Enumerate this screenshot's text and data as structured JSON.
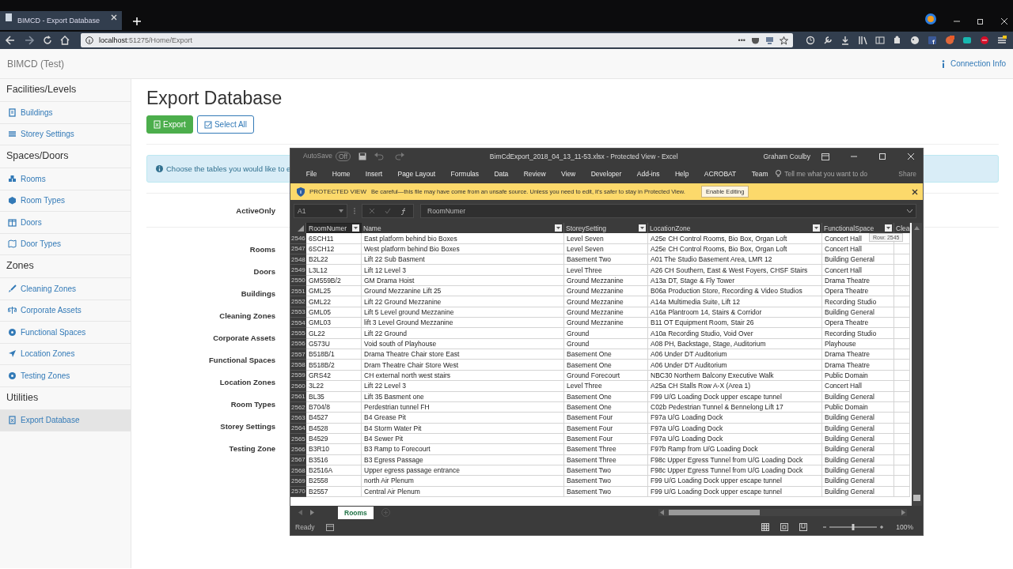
{
  "browser": {
    "tab_title": "BIMCD - Export Database",
    "url_host": "localhost",
    "url_path": ":51275/Home/Export",
    "more": "•••"
  },
  "navbar": {
    "brand": "BIMCD (Test)",
    "connection_info": "Connection Info"
  },
  "sidebar": {
    "sections": [
      {
        "heading": "Facilities/Levels",
        "items": [
          {
            "label": "Buildings",
            "selected": false
          },
          {
            "label": "Storey Settings",
            "selected": false
          }
        ]
      },
      {
        "heading": "Spaces/Doors",
        "items": [
          {
            "label": "Rooms",
            "selected": false
          },
          {
            "label": "Room Types",
            "selected": false
          },
          {
            "label": "Doors",
            "selected": false
          },
          {
            "label": "Door Types",
            "selected": false
          }
        ]
      },
      {
        "heading": "Zones",
        "items": [
          {
            "label": "Cleaning Zones",
            "selected": false
          },
          {
            "label": "Corporate Assets",
            "selected": false
          },
          {
            "label": "Functional Spaces",
            "selected": false
          },
          {
            "label": "Location Zones",
            "selected": false
          },
          {
            "label": "Testing Zones",
            "selected": false
          }
        ]
      },
      {
        "heading": "Utilities",
        "items": [
          {
            "label": "Export Database",
            "selected": true
          }
        ]
      }
    ]
  },
  "page": {
    "title": "Export Database",
    "buttons": [
      {
        "label": "Export",
        "kind": "primary"
      },
      {
        "label": "Select All",
        "kind": "outline"
      }
    ],
    "alert": "Choose the tables you would like to e",
    "active_label": "ActiveOnly",
    "table_labels": [
      "Rooms",
      "Doors",
      "Buildings",
      "Cleaning Zones",
      "Corporate Assets",
      "Functional Spaces",
      "Location Zones",
      "Room Types",
      "Storey Settings",
      "Testing Zone"
    ]
  },
  "excel": {
    "autosave": "AutoSave",
    "autosave_state": "Off",
    "title": "BimCdExport_2018_04_13_11-53.xlsx  -  Protected View  -  Excel",
    "user": "Graham Coulby",
    "ribbon_tabs": [
      "File",
      "Home",
      "Insert",
      "Page Layout",
      "Formulas",
      "Data",
      "Review",
      "View",
      "Developer",
      "Add-ins",
      "Help",
      "ACROBAT",
      "Team"
    ],
    "tell_me": "Tell me what you want to do",
    "share": "Share",
    "protected": {
      "label": "PROTECTED VIEW",
      "message": "Be careful—this file may have come from an unsafe source. Unless you need to edit, it's safer to stay in Protected View.",
      "button": "Enable Editing"
    },
    "name_box": "A1",
    "formula": "RoomNumer",
    "columns": [
      {
        "label": "RoomNumer",
        "selected": true
      },
      {
        "label": "Name",
        "selected": false
      },
      {
        "label": "StoreySetting",
        "selected": false
      },
      {
        "label": "LocationZone",
        "selected": false
      },
      {
        "label": "FunctionalSpace",
        "selected": false
      },
      {
        "label": "Clea",
        "selected": false
      }
    ],
    "rows": [
      {
        "n": "2546",
        "cells": [
          "6SCH11",
          "East platform behind bio Boxes",
          "Level Seven",
          "A25e CH Control Rooms, Bio Box, Organ Loft",
          "Concert Hall"
        ]
      },
      {
        "n": "2547",
        "cells": [
          "6SCH12",
          "West platform behind Bio Boxes",
          "Level Seven",
          "A25e CH Control Rooms, Bio Box, Organ Loft",
          "Concert Hall"
        ]
      },
      {
        "n": "2548",
        "cells": [
          "B2L22",
          "Lift 22 Sub Basment",
          "Basement Two",
          "A01 The Studio Basement Area, LMR 12",
          "Building General"
        ]
      },
      {
        "n": "2549",
        "cells": [
          "L3L12",
          "Lift 12 Level 3",
          "Level Three",
          "A26 CH Southern, East & West Foyers, CHSF Stairs",
          "Concert Hall"
        ]
      },
      {
        "n": "2550",
        "cells": [
          "GM559B/2",
          "GM Drama Hoist",
          "Ground Mezzanine",
          "A13a DT, Stage & Fly Tower",
          "Drama Theatre"
        ]
      },
      {
        "n": "2551",
        "cells": [
          "GML25",
          "Ground Mezzanine Lift 25",
          "Ground Mezzanine",
          "B06a Production Store, Recording & Video Studios",
          "Opera Theatre"
        ]
      },
      {
        "n": "2552",
        "cells": [
          "GML22",
          "Lift 22 Ground Mezzanine",
          "Ground Mezzanine",
          "A14a Multimedia Suite, Lift 12",
          "Recording Studio"
        ]
      },
      {
        "n": "2553",
        "cells": [
          "GML05",
          "Lift 5 Level ground Mezzanine",
          "Ground Mezzanine",
          "A16a Plantroom 14, Stairs & Corridor",
          "Building General"
        ]
      },
      {
        "n": "2554",
        "cells": [
          "GML03",
          "lift 3 Level Ground Mezzanine",
          "Ground Mezzanine",
          "B11 OT Equipment Room, Stair 26",
          "Opera Theatre"
        ]
      },
      {
        "n": "2555",
        "cells": [
          "GL22",
          "Lift 22 Ground",
          "Ground",
          "A10a Recording Studio, Void Over",
          "Recording Studio"
        ]
      },
      {
        "n": "2556",
        "cells": [
          "G573U",
          "Void south of Playhouse",
          "Ground",
          "A08 PH, Backstage, Stage, Auditorium",
          "Playhouse"
        ]
      },
      {
        "n": "2557",
        "cells": [
          "B518B/1",
          "Drama Theatre Chair store East",
          "Basement One",
          "A06 Under DT Auditorium",
          "Drama Theatre"
        ]
      },
      {
        "n": "2558",
        "cells": [
          "B518B/2",
          "Dram Theatre Chair Store West",
          "Basement One",
          "A06 Under DT Auditorium",
          "Drama Theatre"
        ]
      },
      {
        "n": "2559",
        "cells": [
          "GRS42",
          "CH external north west stairs",
          "Ground Forecourt",
          "NBC30 Northern Balcony Executive Walk",
          "Public Domain"
        ]
      },
      {
        "n": "2560",
        "cells": [
          "3L22",
          "Lift 22 Level 3",
          "Level Three",
          "A25a CH Stalls Row A-X (Area 1)",
          "Concert Hall"
        ]
      },
      {
        "n": "2561",
        "cells": [
          "BL35",
          "Lift 35 Basment one",
          "Basement One",
          "F99 U/G Loading Dock upper escape tunnel",
          "Building General"
        ]
      },
      {
        "n": "2562",
        "cells": [
          "B704/8",
          "Perdestrian tunnel FH",
          "Basement One",
          "C02b Pedestrian Tunnel & Bennelong Lift 17",
          "Public Domain"
        ]
      },
      {
        "n": "2563",
        "cells": [
          "B4527",
          "B4 Grease Pit",
          "Basement Four",
          "F97a U/G Loading Dock",
          "Building General"
        ]
      },
      {
        "n": "2564",
        "cells": [
          "B4528",
          "B4 Storm Water Pit",
          "Basement Four",
          "F97a U/G Loading Dock",
          "Building General"
        ]
      },
      {
        "n": "2565",
        "cells": [
          "B4529",
          "B4 Sewer Pit",
          "Basement Four",
          "F97a U/G Loading Dock",
          "Building General"
        ]
      },
      {
        "n": "2566",
        "cells": [
          "B3R10",
          "B3 Ramp to Forecourt",
          "Basement Three",
          "F97b Ramp from U/G Loading Dock",
          "Building General"
        ]
      },
      {
        "n": "2567",
        "cells": [
          "B3516",
          "B3 Egress Passage",
          "Basement Three",
          "F98c Upper Egress Tunnel from U/G Loading Dock",
          "Building General"
        ]
      },
      {
        "n": "2568",
        "cells": [
          "B2516A",
          "Upper egress passage entrance",
          "Basement Two",
          "F98c Upper Egress Tunnel from U/G Loading Dock",
          "Building General"
        ]
      },
      {
        "n": "2569",
        "cells": [
          "B2558",
          "north Air Plenum",
          "Basement Two",
          "F99 U/G Loading Dock upper escape tunnel",
          "Building General"
        ]
      },
      {
        "n": "2570",
        "cells": [
          "B2557",
          "Central Air Plenum",
          "Basement Two",
          "F99 U/G Loading Dock upper escape tunnel",
          "Building General"
        ]
      }
    ],
    "tooltip": "Row: 2545",
    "sheets": [
      {
        "label": "Rooms",
        "selected": true
      }
    ],
    "status": "Ready",
    "zoom_slider": {
      "level": 0.5
    },
    "zoom": "100%"
  }
}
